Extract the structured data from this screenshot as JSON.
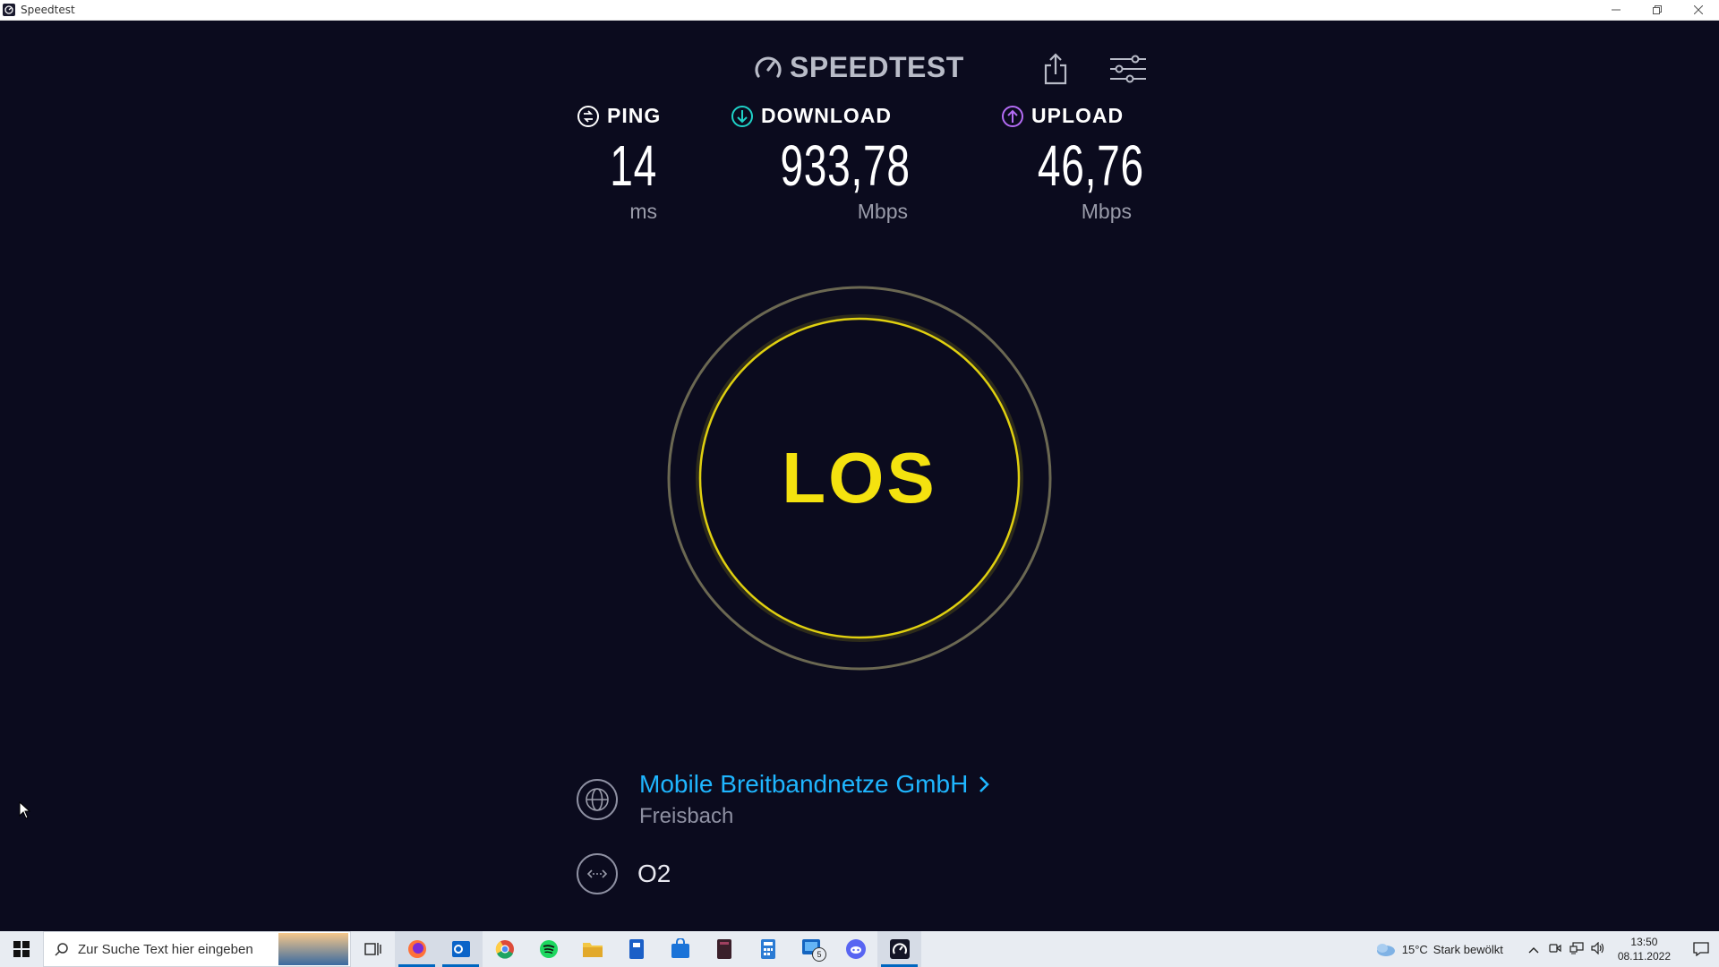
{
  "window": {
    "title": "Speedtest"
  },
  "header": {
    "logo_text": "SPEEDTEST"
  },
  "metrics": {
    "ping": {
      "label": "PING",
      "value": "14",
      "unit": "ms"
    },
    "download": {
      "label": "DOWNLOAD",
      "value": "933,78",
      "unit": "Mbps"
    },
    "upload": {
      "label": "UPLOAD",
      "value": "46,76",
      "unit": "Mbps"
    }
  },
  "go_button": {
    "label": "LOS"
  },
  "server": {
    "isp": "Mobile Breitbandnetze GmbH",
    "location": "Freisbach"
  },
  "connection": {
    "carrier": "O2"
  },
  "taskbar": {
    "search_placeholder": "Zur Suche Text hier eingeben",
    "apps": [
      "task-view",
      "firefox",
      "outlook",
      "chrome",
      "spotify",
      "file-explorer",
      "app-blue",
      "microsoft-store",
      "app-dark",
      "calculator",
      "app-badge",
      "discord",
      "speedtest"
    ],
    "badge_count": "5",
    "weather_temp": "15°C",
    "weather_text": "Stark bewölkt",
    "time": "13:50",
    "date": "08.11.2022"
  },
  "colors": {
    "background": "#0b0b1e",
    "accent_yellow": "#f4e20f",
    "link_blue": "#1fb6ff",
    "download_icon": "#1fd2c8",
    "upload_icon": "#b46cf5"
  }
}
